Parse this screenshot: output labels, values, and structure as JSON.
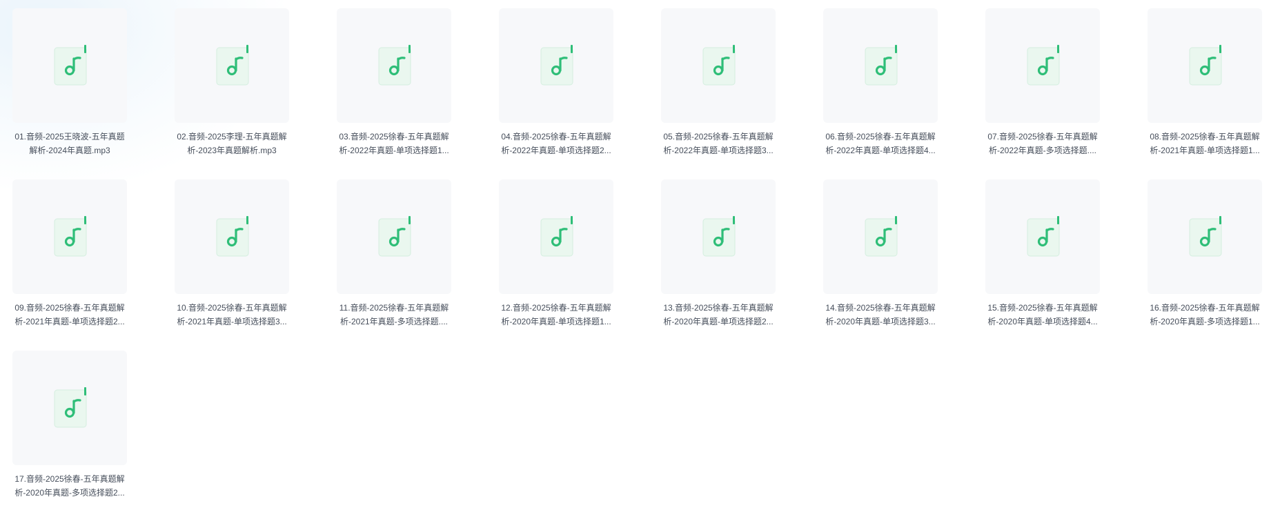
{
  "colors": {
    "icon_green": "#2fbe78",
    "icon_bg": "#eaf7ef",
    "thumb_bg": "#f7f8fa",
    "text": "#454d5a"
  },
  "files": [
    {
      "line1": "01.音频-2025王晓波-五年真题",
      "line2": "解析-2024年真题.mp3",
      "icon": "audio-file-icon"
    },
    {
      "line1": "02.音频-2025李理-五年真题解",
      "line2": "析-2023年真题解析.mp3",
      "icon": "audio-file-icon"
    },
    {
      "line1": "03.音频-2025徐春-五年真题解",
      "line2": "析-2022年真题-单项选择题1...",
      "icon": "audio-file-icon"
    },
    {
      "line1": "04.音频-2025徐春-五年真题解",
      "line2": "析-2022年真题-单项选择题2...",
      "icon": "audio-file-icon"
    },
    {
      "line1": "05.音频-2025徐春-五年真题解",
      "line2": "析-2022年真题-单项选择题3...",
      "icon": "audio-file-icon"
    },
    {
      "line1": "06.音频-2025徐春-五年真题解",
      "line2": "析-2022年真题-单项选择题4...",
      "icon": "audio-file-icon"
    },
    {
      "line1": "07.音频-2025徐春-五年真题解",
      "line2": "析-2022年真题-多项选择题....",
      "icon": "audio-file-icon"
    },
    {
      "line1": "08.音频-2025徐春-五年真题解",
      "line2": "析-2021年真题-单项选择题1...",
      "icon": "audio-file-icon"
    },
    {
      "line1": "09.音频-2025徐春-五年真题解",
      "line2": "析-2021年真题-单项选择题2...",
      "icon": "audio-file-icon"
    },
    {
      "line1": "10.音频-2025徐春-五年真题解",
      "line2": "析-2021年真题-单项选择题3...",
      "icon": "audio-file-icon"
    },
    {
      "line1": "11.音频-2025徐春-五年真题解",
      "line2": "析-2021年真题-多项选择题....",
      "icon": "audio-file-icon"
    },
    {
      "line1": "12.音频-2025徐春-五年真题解",
      "line2": "析-2020年真题-单项选择题1...",
      "icon": "audio-file-icon"
    },
    {
      "line1": "13.音频-2025徐春-五年真题解",
      "line2": "析-2020年真题-单项选择题2...",
      "icon": "audio-file-icon"
    },
    {
      "line1": "14.音频-2025徐春-五年真题解",
      "line2": "析-2020年真题-单项选择题3...",
      "icon": "audio-file-icon"
    },
    {
      "line1": "15.音频-2025徐春-五年真题解",
      "line2": "析-2020年真题-单项选择题4...",
      "icon": "audio-file-icon"
    },
    {
      "line1": "16.音频-2025徐春-五年真题解",
      "line2": "析-2020年真题-多项选择题1...",
      "icon": "audio-file-icon"
    },
    {
      "line1": "17.音频-2025徐春-五年真题解",
      "line2": "析-2020年真题-多项选择题2...",
      "icon": "audio-file-icon"
    }
  ]
}
